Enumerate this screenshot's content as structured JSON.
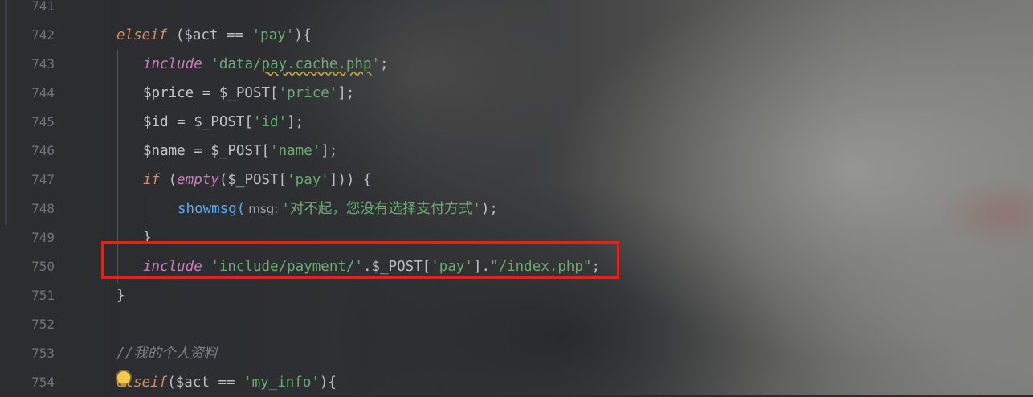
{
  "editor": {
    "line_numbers": [
      "741",
      "742",
      "743",
      "744",
      "745",
      "746",
      "747",
      "748",
      "749",
      "750",
      "751",
      "752",
      "753",
      "754"
    ],
    "lines": {
      "l742": {
        "kw": "elseif",
        "a": " ($act ",
        "op": "==",
        "b": " ",
        "str": "'pay'",
        "c": "){"
      },
      "l743": {
        "kw": "include",
        "sp": " ",
        "q1": "'data/",
        "wavy": "pay.cache.php",
        "q2": "'",
        "end": ";"
      },
      "l744": {
        "var": "$price",
        "mid": " = $_POST[",
        "str": "'price'",
        "end": "];"
      },
      "l745": {
        "var": "$id",
        "mid": " = $_POST[",
        "str": "'id'",
        "end": "];"
      },
      "l746": {
        "var": "$name",
        "mid": " = $_POST[",
        "str": "'name'",
        "end": "];"
      },
      "l747": {
        "kw": "if",
        "a": " (",
        "fn": "empty",
        "b": "($_POST[",
        "str": "'pay'",
        "c": "])) {"
      },
      "l748": {
        "fn": "showmsg(",
        "hint": "msg:",
        "str": "'对不起，您没有选择支付方式'",
        "end": ");"
      },
      "l749": {
        "text": "}"
      },
      "l750": {
        "kw": "include",
        "sp": " ",
        "s1": "'include/payment/'",
        "mid": ".$_POST[",
        "s2": "'pay'",
        "mid2": "].",
        "s3": "\"/index.php\"",
        "end": ";"
      },
      "l751": {
        "text": "}"
      },
      "l753": {
        "comment": "//我的个人资料"
      },
      "l754": {
        "kw": "elseif",
        "a": "($act ",
        "op": "==",
        "b": " ",
        "str": "'my_info'",
        "c": "){"
      }
    }
  },
  "colors": {
    "highlight_box": "#e0241b",
    "keyword": "#cf8e6d",
    "string": "#6aab73",
    "function": "#56a8f5",
    "include": "#c77dbb"
  },
  "icons": {
    "bulb": "lightbulb-icon"
  }
}
